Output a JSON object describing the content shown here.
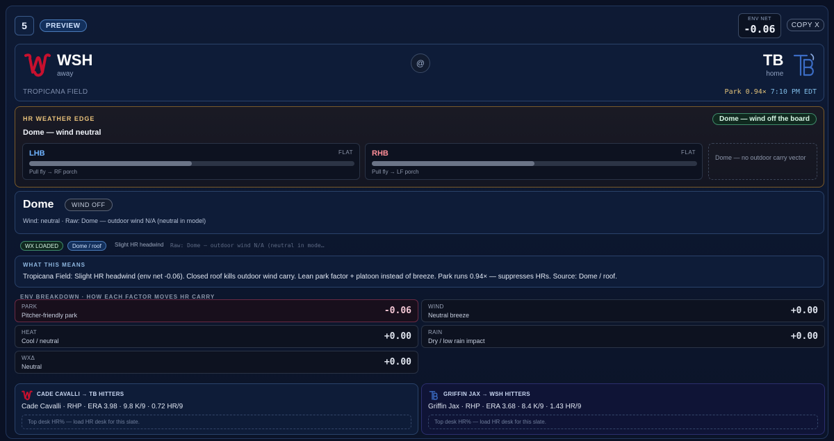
{
  "header": {
    "game_number": "5",
    "status_badge": "PREVIEW",
    "env_net_label": "ENV NET",
    "env_net_value": "-0.06",
    "copy_label": "COPY X"
  },
  "matchup": {
    "away": {
      "code": "WSH",
      "role": "away",
      "logo_color": "#c8102e"
    },
    "at": "@",
    "home": {
      "code": "TB",
      "role": "home",
      "logo_color": "#3b6cc4"
    },
    "venue": "TROPICANA FIELD",
    "park": "Park 0.94×",
    "time": "7:10 PM EDT"
  },
  "weather_edge": {
    "title": "HR WEATHER EDGE",
    "subtitle": "Dome — wind neutral",
    "dome_pill": "Dome — wind off the board",
    "lhb": {
      "label": "LHB",
      "state": "FLAT",
      "desc": "Pull fly → RF porch",
      "fill": 0.5,
      "color": "#6fb3ff"
    },
    "rhb": {
      "label": "RHB",
      "state": "FLAT",
      "desc": "Pull fly → LF porch",
      "fill": 0.5,
      "color": "#ff8e98"
    },
    "no_vector": "Dome — no outdoor carry vector"
  },
  "dome": {
    "title": "Dome",
    "badge": "WIND OFF",
    "wind_line": "Wind: neutral · Raw: Dome — outdoor wind N/A (neutral in model)"
  },
  "chips": {
    "wx_loaded": "WX LOADED",
    "roof": "Dome / roof",
    "headwind": "Slight HR headwind",
    "raw": "Raw: Dome — outdoor wind N/A (neutral in mode…"
  },
  "what_this_means": {
    "title": "WHAT THIS MEANS",
    "body": "Tropicana Field: Slight HR headwind (env net -0.06). Closed roof kills outdoor wind carry. Lean park factor + platoon instead of breeze. Park runs 0.94× — suppresses HRs. Source: Dome / roof."
  },
  "env_breakdown": {
    "title": "ENV BREAKDOWN · HOW EACH FACTOR MOVES HR CARRY",
    "factors": [
      {
        "name": "PARK",
        "desc": "Pitcher-friendly park",
        "value": "-0.06"
      },
      {
        "name": "WIND",
        "desc": "Neutral breeze",
        "value": "+0.00"
      },
      {
        "name": "HEAT",
        "desc": "Cool / neutral",
        "value": "+0.00"
      },
      {
        "name": "RAIN",
        "desc": "Dry / low rain impact",
        "value": "+0.00"
      },
      {
        "name": "WXΔ",
        "desc": "Neutral",
        "value": "+0.00"
      }
    ]
  },
  "pitchers": [
    {
      "title": "CADE CAVALLI → TB HITTERS",
      "line": "Cade Cavalli · RHP · ERA 3.98 · 9.8 K/9 · 0.72 HR/9",
      "desk": "Top desk HR% — load HR desk for this slate.",
      "logo_icon": "nationals-w-logo"
    },
    {
      "title": "GRIFFIN JAX → WSH HITTERS",
      "line": "Griffin Jax · RHP · ERA 3.68 · 8.4 K/9 · 1.43 HR/9",
      "desk": "Top desk HR% — load HR desk for this slate.",
      "logo_icon": "rays-tb-logo"
    }
  ]
}
